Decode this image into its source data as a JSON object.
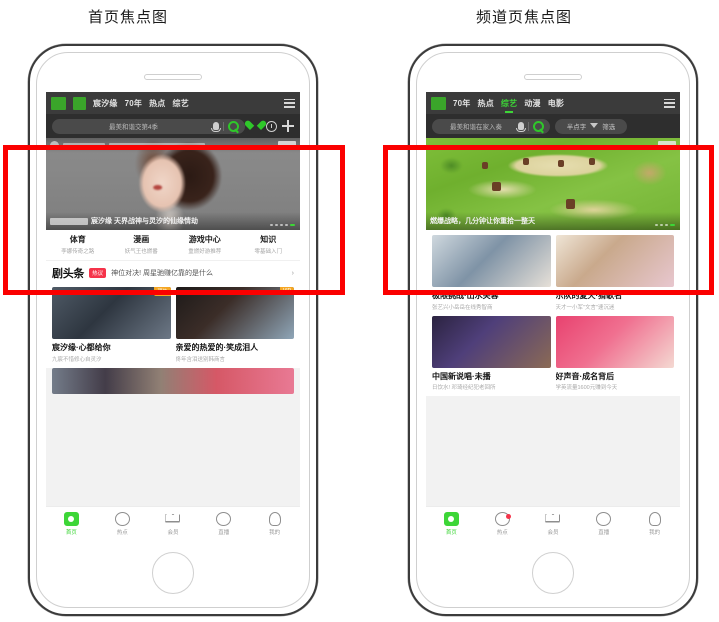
{
  "captions": {
    "left": "首页焦点图",
    "right": "频道页焦点图"
  },
  "colors": {
    "brand_green": "#3dd637",
    "annotation_red": "#fb0000",
    "badge_red": "#f5334a",
    "nav_dark": "#3b3b3b",
    "search_dark": "#2e2e2e"
  },
  "phone_left": {
    "navbar": {
      "logo_label": "爱奇艺",
      "tabs": [
        {
          "label": "宸汐缘",
          "active": false
        },
        {
          "label": "70年",
          "active": false
        },
        {
          "label": "热点",
          "active": false
        },
        {
          "label": "综艺",
          "active": false
        }
      ],
      "menu_icon": "hamburger-icon"
    },
    "searchbar": {
      "query_text": "最美和谐交第4季",
      "mic_icon": "mic-icon",
      "search_icon": "search-icon",
      "heart_icon": "heart-icon",
      "history_icon": "clock-icon",
      "add_icon": "plus-icon"
    },
    "hero": {
      "badge_label": "广告",
      "caption_text": "宸汐缘 天界战神与灵汐的仙缘情劫",
      "dots": 5,
      "active_dot": 5
    },
    "categories": [
      {
        "name": "体育",
        "sub": "李娜传奇之路"
      },
      {
        "name": "漫画",
        "sub": "妖气王也燃番"
      },
      {
        "name": "游戏中心",
        "sub": "重燃好游推荐"
      },
      {
        "name": "知识",
        "sub": "零基础入门"
      }
    ],
    "headline": {
      "title": "剧头条",
      "badge": "热议",
      "text": "神位对决! 周星驰赚亿靠的是什么",
      "arrow": "›"
    },
    "cards": [
      {
        "title": "宸汐缘·心都给你",
        "sub": "九宸不惜修心自灵汐",
        "tag": "预告"
      },
      {
        "title": "亲爱的热爱的·笑成泪人",
        "sub": "佟年含泪送别韩商言",
        "tag": "VIP"
      }
    ],
    "tabbar": [
      {
        "label": "首页",
        "active": true,
        "icon": "home-icon",
        "dot": false
      },
      {
        "label": "热点",
        "active": false,
        "icon": "fire-icon",
        "dot": false
      },
      {
        "label": "会员",
        "active": false,
        "icon": "crown-icon",
        "dot": false
      },
      {
        "label": "直播",
        "active": false,
        "icon": "live-icon",
        "dot": false
      },
      {
        "label": "我的",
        "active": false,
        "icon": "profile-icon",
        "dot": false
      }
    ]
  },
  "phone_right": {
    "navbar": {
      "logo_label": "爱奇艺",
      "tabs": [
        {
          "label": "70年",
          "active": false
        },
        {
          "label": "热点",
          "active": false
        },
        {
          "label": "综艺",
          "active": true
        },
        {
          "label": "动漫",
          "active": false
        },
        {
          "label": "电影",
          "active": false
        }
      ],
      "menu_icon": "hamburger-icon"
    },
    "searchbar": {
      "query_text": "最美和谐在家入奏",
      "mic_icon": "mic-icon",
      "search_icon": "search-icon",
      "chip_label": "半点字",
      "filter_icon": "filter-icon",
      "filter_label": "筛选"
    },
    "hero": {
      "badge_label": "广告",
      "caption_text": "燃爆战略，几分钟让你重拾一整天",
      "dots": 4,
      "active_dot": 4
    },
    "cards_row1": [
      {
        "title": "极限挑战·出水芙蓉",
        "sub": "张艺兴小岳岳在线秀智商"
      },
      {
        "title": "乐队的夏天·猜歌名",
        "sub": "天才一小军\"文言\"速沉迷"
      }
    ],
    "cards_row2": [
      {
        "title": "中国新说唱·未播",
        "sub": "日饮水! 邓琦经纪犯老回所"
      },
      {
        "title": "好声音·成名背后",
        "sub": "学英流量1600元赚到今天"
      }
    ],
    "tabbar": [
      {
        "label": "首页",
        "active": true,
        "icon": "home-icon",
        "dot": false
      },
      {
        "label": "热点",
        "active": false,
        "icon": "fire-icon",
        "dot": true
      },
      {
        "label": "会员",
        "active": false,
        "icon": "crown-icon",
        "dot": false
      },
      {
        "label": "直播",
        "active": false,
        "icon": "live-icon",
        "dot": false
      },
      {
        "label": "我的",
        "active": false,
        "icon": "profile-icon",
        "dot": false
      }
    ]
  }
}
